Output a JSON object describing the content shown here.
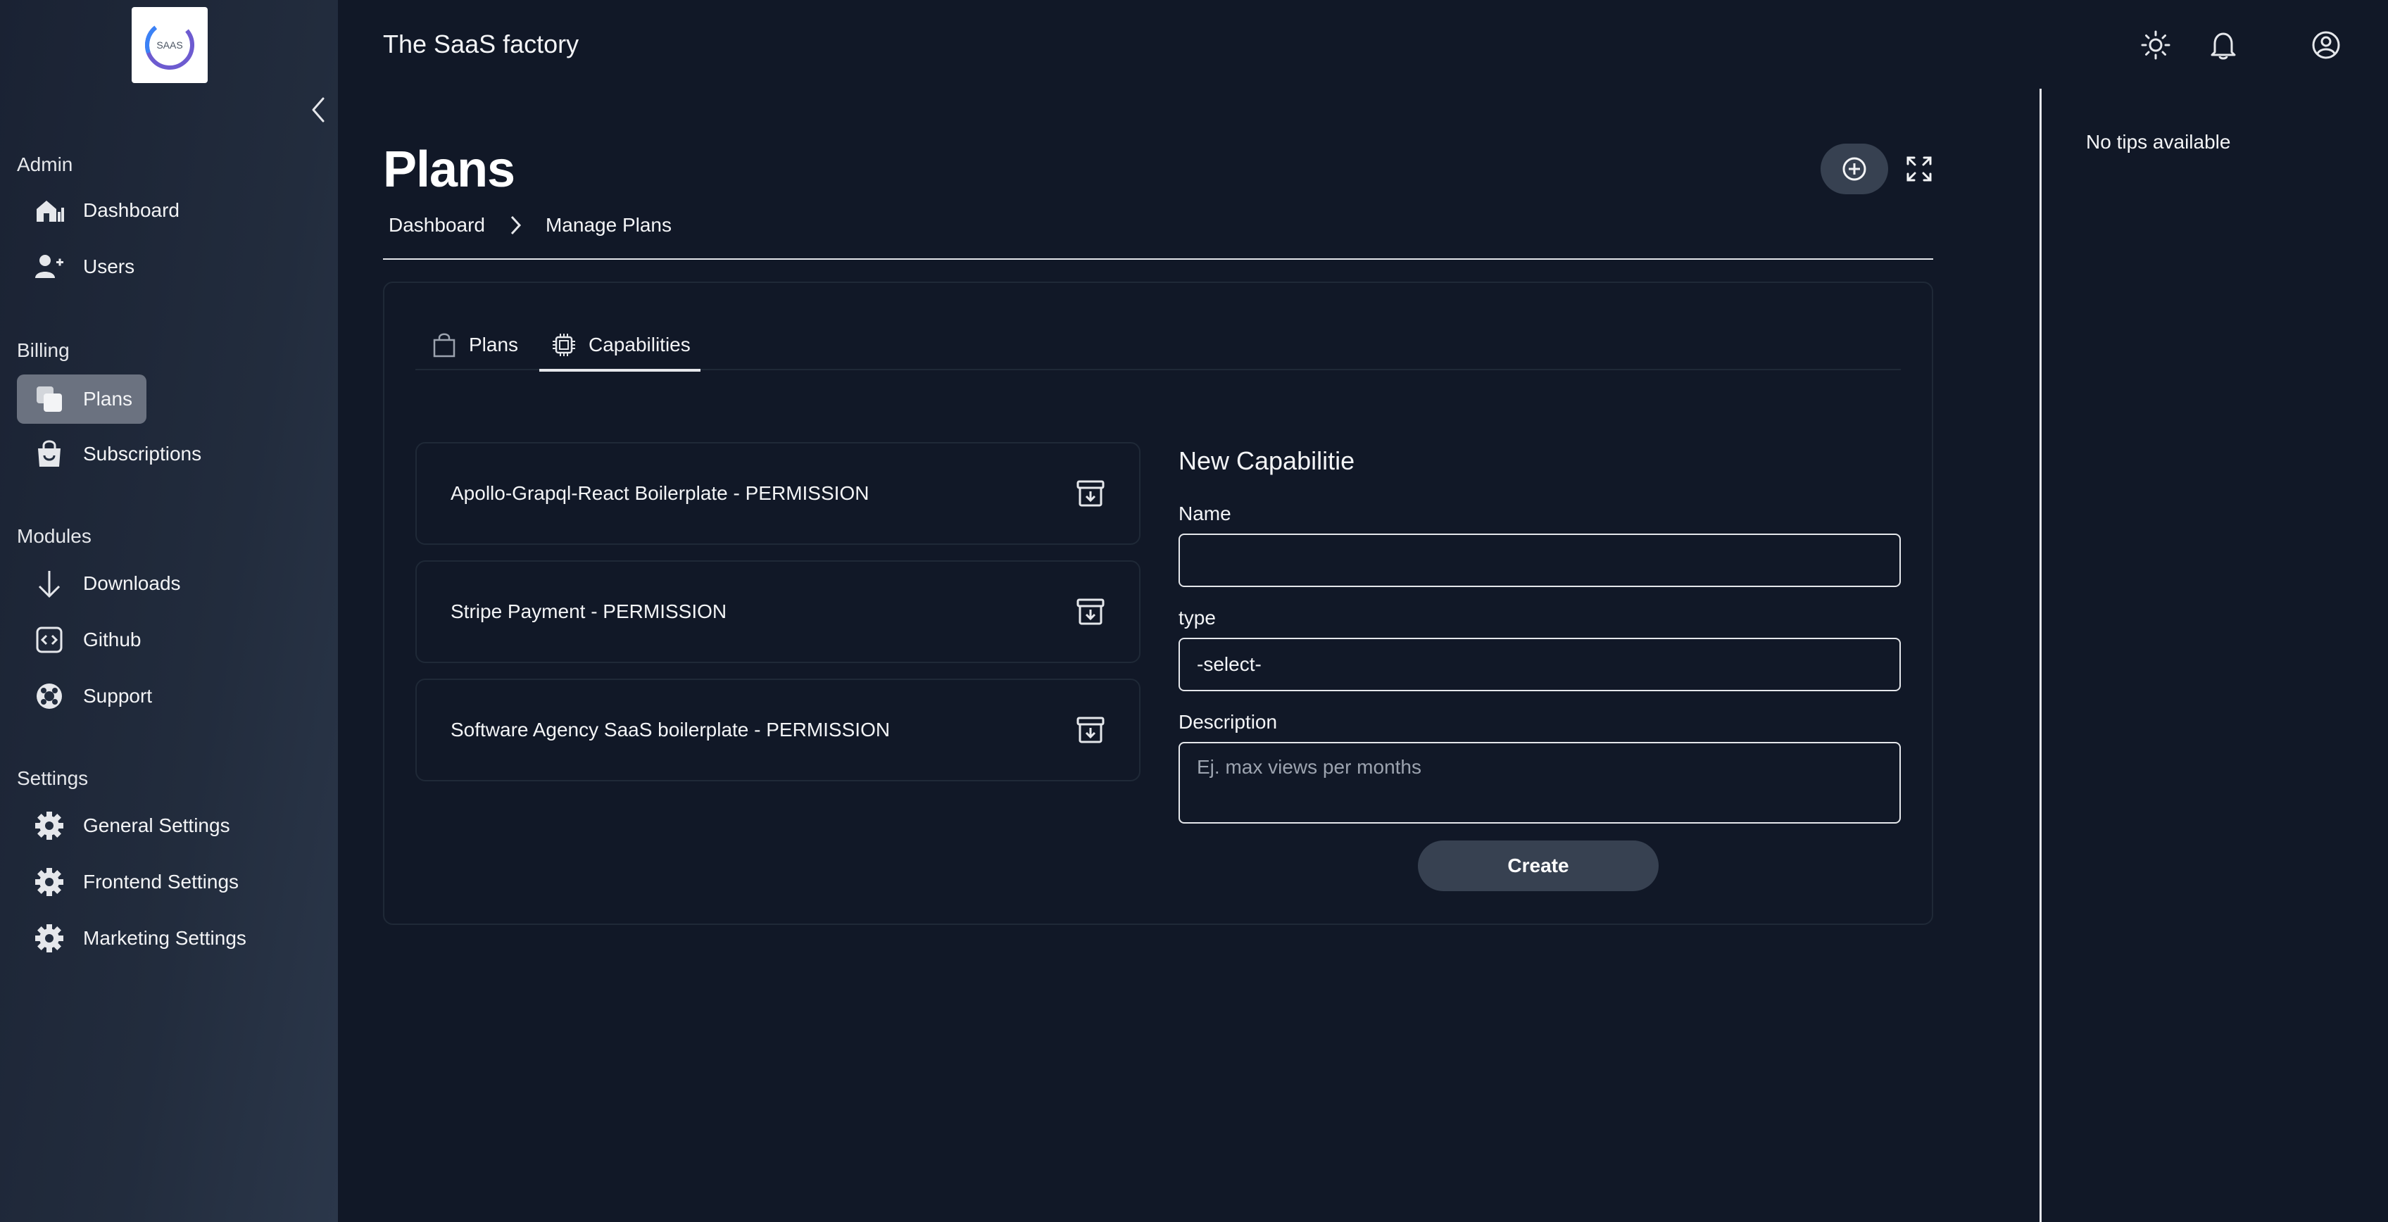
{
  "app": {
    "title": "The SaaS factory",
    "logo_text": "SAAS"
  },
  "sidebar": {
    "sections": {
      "admin": "Admin",
      "billing": "Billing",
      "modules": "Modules",
      "settings": "Settings"
    },
    "items": {
      "dashboard": "Dashboard",
      "users": "Users",
      "plans": "Plans",
      "subscriptions": "Subscriptions",
      "downloads": "Downloads",
      "github": "Github",
      "support": "Support",
      "general_settings": "General Settings",
      "frontend_settings": "Frontend Settings",
      "marketing_settings": "Marketing Settings"
    }
  },
  "tips": {
    "text": "No tips available"
  },
  "page": {
    "title": "Plans",
    "breadcrumb": [
      "Dashboard",
      "Manage Plans"
    ]
  },
  "tabs": [
    "Plans",
    "Capabilities"
  ],
  "capabilities": [
    "Apollo-Grapql-React Boilerplate - PERMISSION",
    "Stripe Payment - PERMISSION",
    "Software Agency SaaS boilerplate - PERMISSION"
  ],
  "form": {
    "title": "New Capabilitie",
    "name_label": "Name",
    "name_value": "",
    "type_label": "type",
    "type_value": "-select-",
    "description_label": "Description",
    "description_placeholder": "Ej. max views per months",
    "create_label": "Create"
  }
}
